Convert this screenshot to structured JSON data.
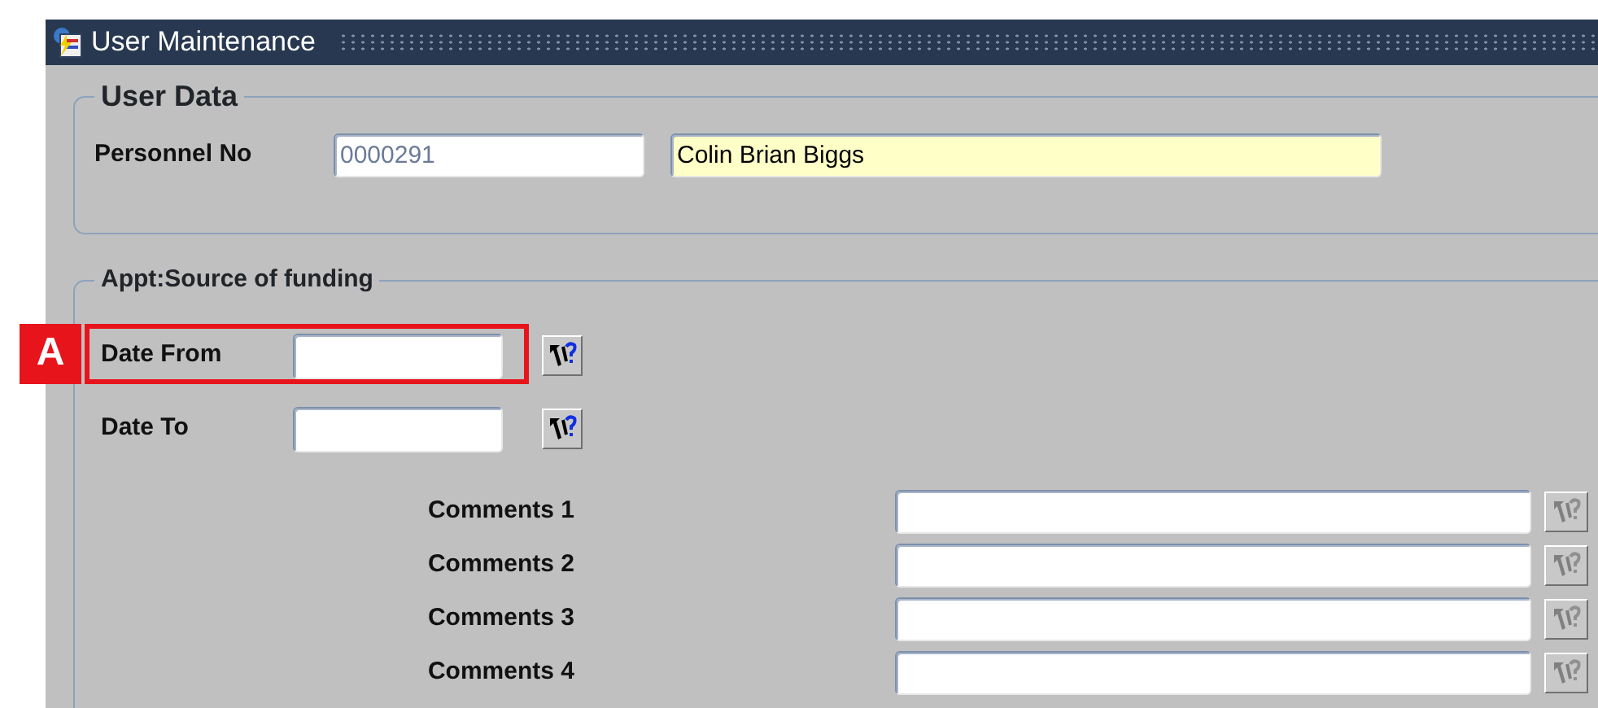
{
  "window": {
    "title": "User Maintenance"
  },
  "user_data": {
    "legend": "User Data",
    "label": "Personnel No",
    "fields": [
      {
        "value": "0000291",
        "kind": "readonly"
      },
      {
        "value": "Colin Brian Biggs",
        "kind": "query"
      }
    ]
  },
  "funding": {
    "legend": "Appt:Source of funding",
    "date_fields": [
      {
        "label": "Date From",
        "highlighted": true,
        "callout": "A",
        "button_disabled": false
      },
      {
        "label": "Date To",
        "highlighted": false,
        "button_disabled": false
      }
    ],
    "comments": [
      {
        "label": "Comments 1",
        "button_disabled": true
      },
      {
        "label": "Comments 2",
        "button_disabled": true
      },
      {
        "label": "Comments 3",
        "button_disabled": true
      },
      {
        "label": "Comments 4",
        "button_disabled": true
      }
    ]
  }
}
